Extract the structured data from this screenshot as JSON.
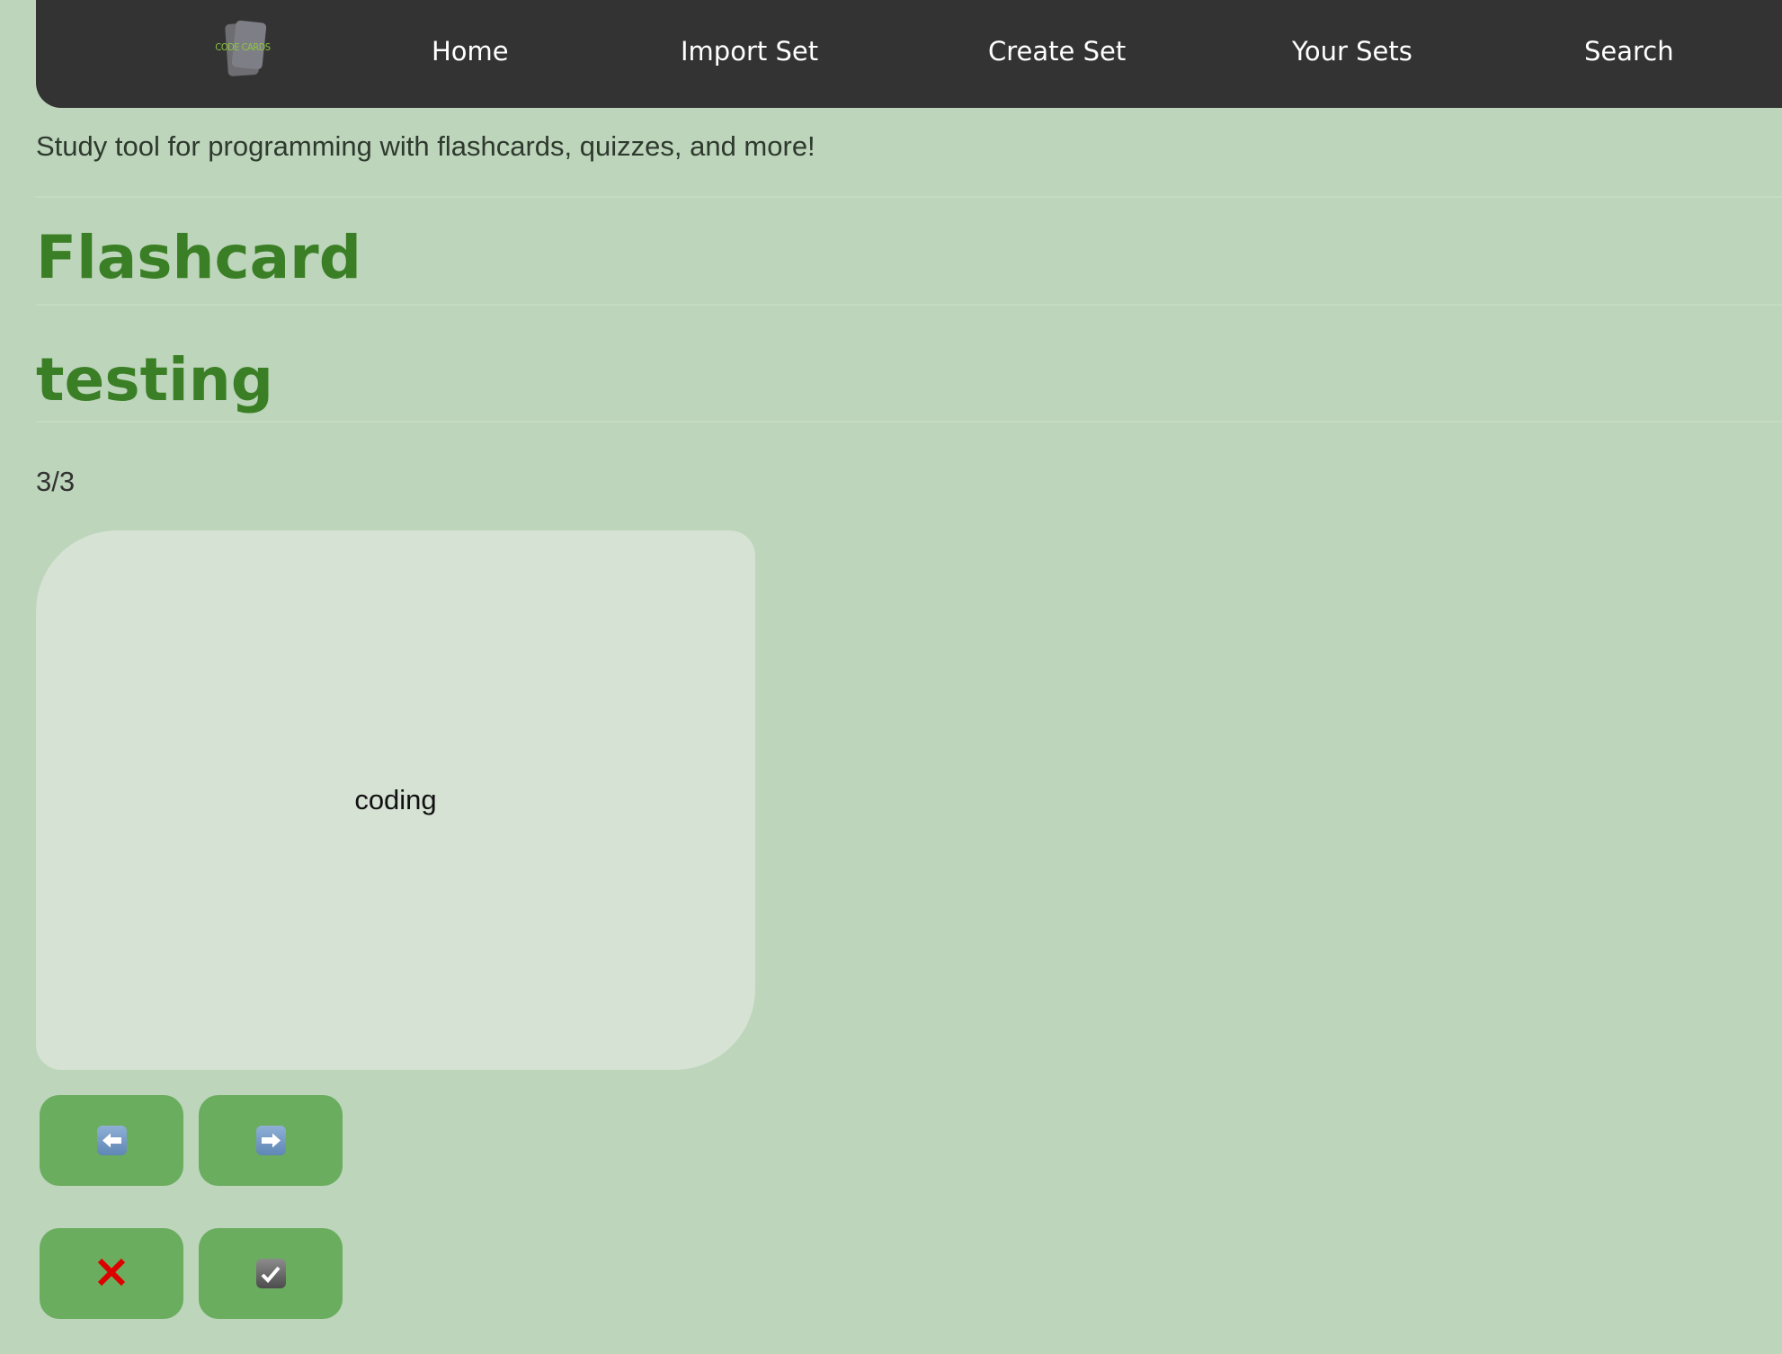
{
  "navbar": {
    "logo_text": "CODE CARDS",
    "links": [
      "Home",
      "Import Set",
      "Create Set",
      "Your Sets",
      "Search"
    ]
  },
  "tagline": "Study tool for programming with flashcards, quizzes, and more!",
  "page_title": "Flashcard",
  "set_title": "testing",
  "counter": "3/3",
  "card": {
    "text": "coding"
  },
  "controls": {
    "prev_icon": "arrow-left-icon",
    "next_icon": "arrow-right-icon",
    "wrong_icon": "cross-mark-icon",
    "right_icon": "check-mark-icon"
  },
  "colors": {
    "background": "#bdd5bb",
    "navbar": "#333333",
    "heading": "#3a7f25",
    "button": "#6aad5e",
    "card": "#d6e2d3",
    "cross": "#dd0000"
  }
}
